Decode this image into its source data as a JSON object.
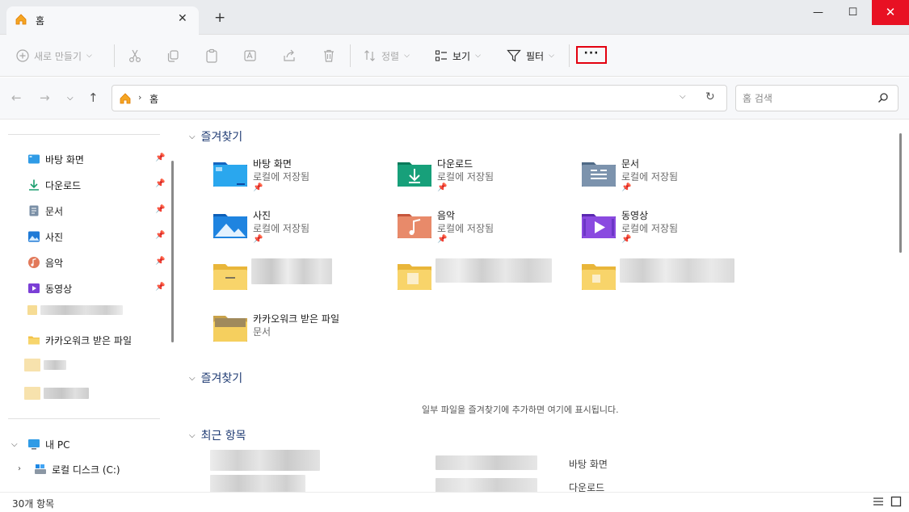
{
  "tab": {
    "title": "홈"
  },
  "toolbar": {
    "new_label": "새로 만들기",
    "sort_label": "정렬",
    "view_label": "보기",
    "filter_label": "필터",
    "more_label": "···"
  },
  "address": {
    "crumb": "홈"
  },
  "search": {
    "placeholder": "홈 검색"
  },
  "sidebar": {
    "items": [
      {
        "label": "바탕 화면"
      },
      {
        "label": "다운로드"
      },
      {
        "label": "문서"
      },
      {
        "label": "사진"
      },
      {
        "label": "음악"
      },
      {
        "label": "동영상"
      },
      {
        "label": "카카오워크 받은 파일"
      }
    ],
    "pc_label": "내 PC",
    "drive_label": "로컬 디스크 (C:)"
  },
  "sections": {
    "favorites1": "즐겨찾기",
    "favorites2": "즐겨찾기",
    "recent": "최근 항목"
  },
  "quick_access": [
    {
      "name": "바탕 화면",
      "sub": "로컬에 저장됨"
    },
    {
      "name": "다운로드",
      "sub": "로컬에 저장됨"
    },
    {
      "name": "문서",
      "sub": "로컬에 저장됨"
    },
    {
      "name": "사진",
      "sub": "로컬에 저장됨"
    },
    {
      "name": "음악",
      "sub": "로컬에 저장됨"
    },
    {
      "name": "동영상",
      "sub": "로컬에 저장됨"
    },
    {
      "name": "카카오워크 받은 파일",
      "sub": "문서"
    }
  ],
  "favorites_empty_message": "일부 파일을 즐겨찾기에 추가하면 여기에 표시됩니다.",
  "recent_locations": [
    "바탕 화면",
    "다운로드"
  ],
  "status": {
    "count": "30개 항목"
  },
  "colors": {
    "close_red": "#e81123",
    "highlight_red": "#e3000f",
    "section_blue": "#1f3b73"
  }
}
